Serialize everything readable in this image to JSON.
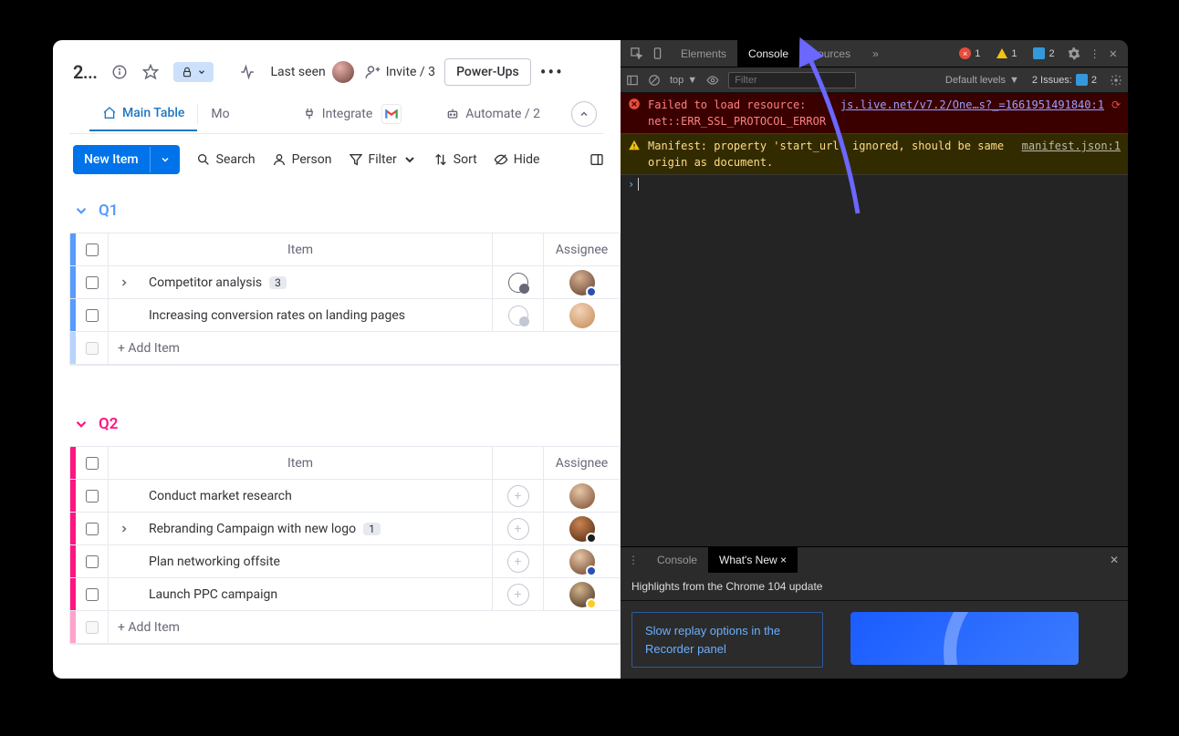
{
  "app": {
    "title": "2...",
    "lock_label": "",
    "last_seen": "Last seen",
    "invite": "Invite / 3",
    "powerups": "Power-Ups"
  },
  "tabs": {
    "main": "Main Table",
    "mo": "Mo",
    "integrate": "Integrate",
    "automate": "Automate / 2"
  },
  "toolbar": {
    "new_item": "New Item",
    "search": "Search",
    "person": "Person",
    "filter": "Filter",
    "sort": "Sort",
    "hide": "Hide"
  },
  "groups": [
    {
      "id": "q1",
      "title": "Q1",
      "columns": {
        "item": "Item",
        "assignee": "Assignee"
      },
      "rows": [
        {
          "expand": true,
          "name": "Competitor analysis",
          "count": "3",
          "msg": "filled",
          "avatar_bg": "radial-gradient(circle at 40% 30%, #d8b090, #5a3b2c)",
          "avatar_badge": "#2b4fb2"
        },
        {
          "expand": false,
          "name": "Increasing conversion rates on landing pages",
          "count": null,
          "msg": "filled",
          "avatar_bg": "radial-gradient(circle at 40% 30%, #f4d2b8, #c28a55)",
          "avatar_badge": null
        }
      ],
      "add": "+ Add Item"
    },
    {
      "id": "q2",
      "title": "Q2",
      "columns": {
        "item": "Item",
        "assignee": "Assignee"
      },
      "rows": [
        {
          "expand": false,
          "name": "Conduct market research",
          "count": null,
          "msg": "plus",
          "avatar_bg": "radial-gradient(circle at 40% 30%, #e6c6a8, #7a4a2e)",
          "avatar_badge": null
        },
        {
          "expand": true,
          "name": "Rebranding Campaign with new logo",
          "count": "1",
          "msg": "plus",
          "avatar_bg": "radial-gradient(circle at 40% 30%, #c98350, #4a2610)",
          "avatar_badge": "#1d1d1d"
        },
        {
          "expand": false,
          "name": "Plan networking offsite",
          "count": null,
          "msg": "plus",
          "avatar_bg": "radial-gradient(circle at 40% 30%, #e6c6a8, #6a3d23)",
          "avatar_badge": "#2b4fb2"
        },
        {
          "expand": false,
          "name": "Launch PPC campaign",
          "count": null,
          "msg": "plus",
          "avatar_bg": "radial-gradient(circle at 40% 30%, #d4b38c, #3b2a1a)",
          "avatar_badge": "#ffca28"
        }
      ],
      "add": "+ Add Item"
    }
  ],
  "devtools": {
    "tabs": {
      "elements": "Elements",
      "console": "Console",
      "sources": "Sources"
    },
    "badges": {
      "errors": "1",
      "warnings": "1",
      "msgs": "2"
    },
    "sub": {
      "top": "top",
      "filter_placeholder": "Filter",
      "levels": "Default levels",
      "issues": "2 Issues:",
      "issues_count": "2"
    },
    "logs": [
      {
        "type": "err",
        "text": "Failed to load resource:\nnet::ERR_SSL_PROTOCOL_ERROR",
        "src": "js.live.net/v7.2/One…s?_=1661951491840:1"
      },
      {
        "type": "warn",
        "text": "Manifest: property 'start_url' ignored, should be same origin as document.",
        "src": "manifest.json:1"
      }
    ],
    "drawer": {
      "tab_console": "Console",
      "tab_whatsnew": "What's New",
      "title": "Highlights from the Chrome 104 update",
      "card": "Slow replay options in the Recorder panel"
    }
  }
}
